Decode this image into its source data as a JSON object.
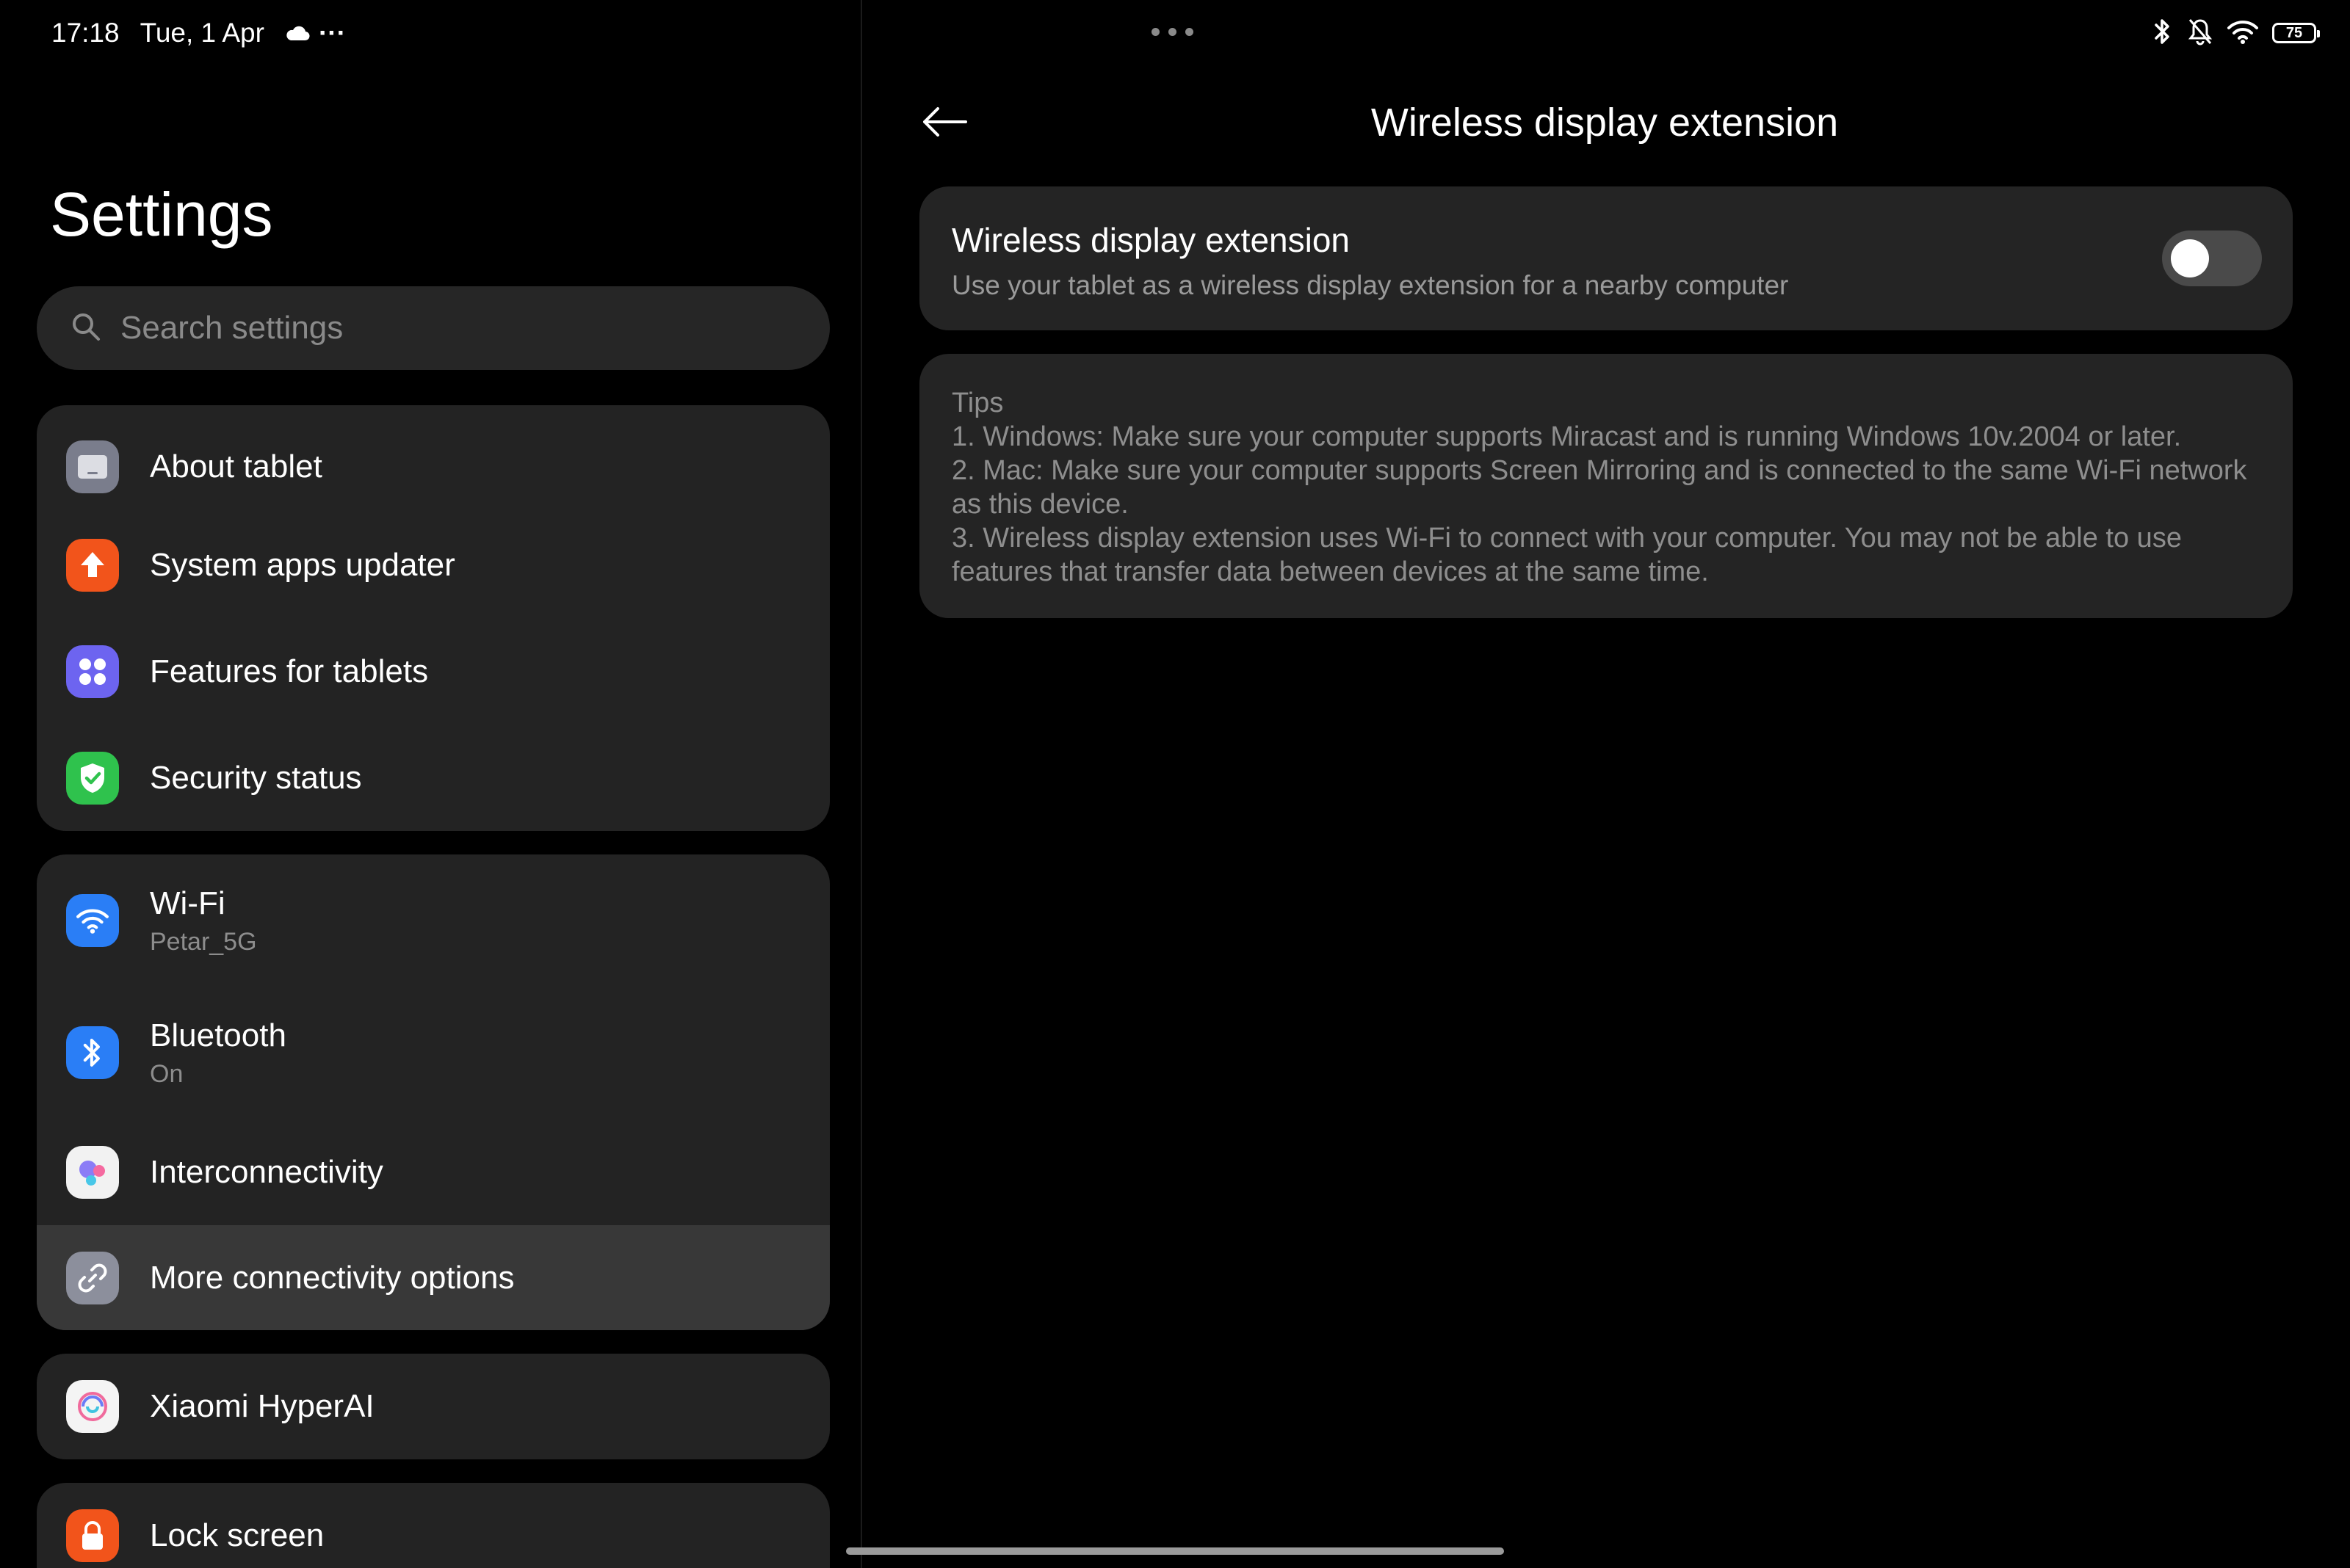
{
  "status_bar": {
    "time": "17:18",
    "date": "Tue, 1 Apr",
    "more": "···",
    "battery_level": "75"
  },
  "sidebar": {
    "title": "Settings",
    "search_placeholder": "Search settings",
    "groups": [
      {
        "items": [
          {
            "label": "About tablet",
            "icon": "tablet-icon",
            "color": "#7a7d8c"
          },
          {
            "label": "System apps updater",
            "icon": "arrow-up-icon",
            "color": "#f2541b"
          },
          {
            "label": "Features for tablets",
            "icon": "four-dots-icon",
            "color": "#6d64f0"
          },
          {
            "label": "Security status",
            "icon": "shield-check-icon",
            "color": "#2fc24d"
          }
        ]
      },
      {
        "items": [
          {
            "label": "Wi-Fi",
            "sublabel": "Petar_5G",
            "icon": "wifi-icon",
            "color": "#2a7ef6"
          },
          {
            "label": "Bluetooth",
            "sublabel": "On",
            "icon": "bluetooth-icon",
            "color": "#2a7ef6"
          },
          {
            "label": "Interconnectivity",
            "icon": "interconnectivity-icon",
            "color": "#f2f2f2"
          },
          {
            "label": "More connectivity options",
            "icon": "link-icon",
            "color": "#8c8f9c",
            "selected": true
          }
        ]
      },
      {
        "items": [
          {
            "label": "Xiaomi HyperAI",
            "icon": "hyperai-icon",
            "color": "#f4f4f4"
          }
        ]
      },
      {
        "items": [
          {
            "label": "Lock screen",
            "icon": "lock-icon",
            "color": "#f2541b"
          }
        ]
      }
    ]
  },
  "detail": {
    "title": "Wireless display extension",
    "toggle": {
      "label": "Wireless display extension",
      "description": "Use your tablet as a wireless display extension for a nearby computer",
      "enabled": false
    },
    "tips": {
      "heading": "Tips",
      "line1": "1. Windows: Make sure your computer supports Miracast and is running Windows 10v.2004 or later.",
      "line2": "2. Mac: Make sure your computer supports Screen Mirroring and is connected to the same Wi-Fi network as this device.",
      "line3": "3. Wireless display extension uses Wi-Fi to connect with your computer. You may not be able to use features that transfer data between devices at the same time."
    }
  }
}
